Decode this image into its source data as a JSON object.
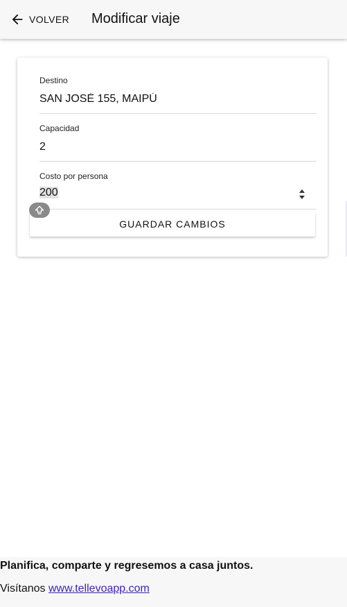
{
  "header": {
    "back_label": "VOLVER",
    "back_icon": "arrow-left-icon",
    "title": "Modificar viaje"
  },
  "form": {
    "destination": {
      "label": "Destino",
      "value": "SAN JOSÉ 155, MAIPÚ"
    },
    "capacity": {
      "label": "Capacidad",
      "value": "2"
    },
    "cost": {
      "label": "Costo por persona",
      "value": "200"
    },
    "save_label": "GUARDAR CAMBIOS"
  },
  "footer": {
    "tagline": "Planifica, comparte y regresemos a casa juntos.",
    "visit_prefix": "Visítanos",
    "link_text": "www.tellevoapp.com"
  },
  "colors": {
    "link": "#3f22c6",
    "header_bg": "#f7f7f7",
    "divider": "#d9d9d9"
  }
}
